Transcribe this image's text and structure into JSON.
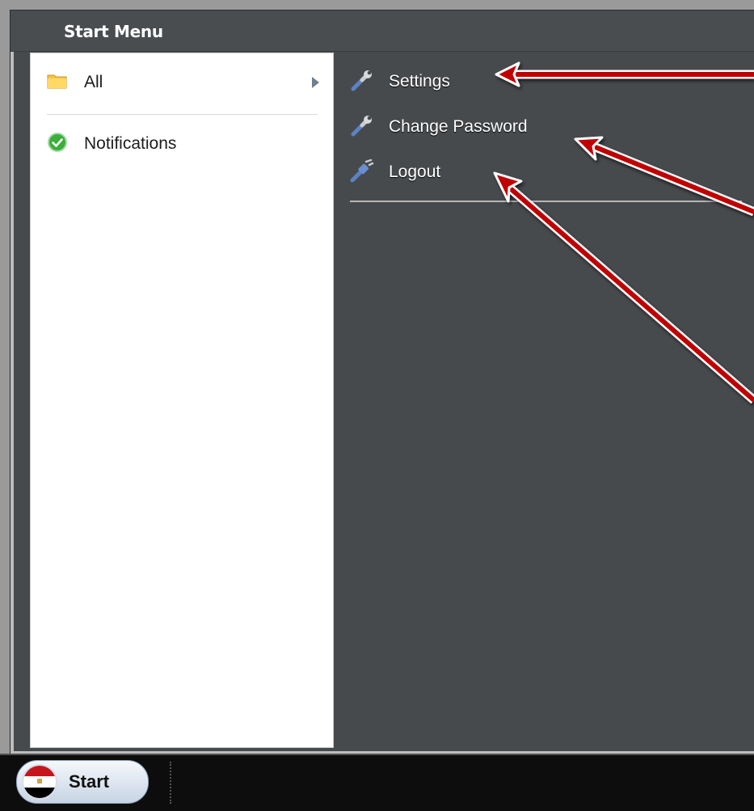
{
  "window": {
    "title": "Start Menu"
  },
  "left_menu": {
    "items": [
      {
        "label": "All",
        "icon": "folder-icon",
        "has_submenu": true
      },
      {
        "label": "Notifications",
        "icon": "check-circle-icon",
        "has_submenu": false
      }
    ]
  },
  "right_menu": {
    "items": [
      {
        "label": "Settings",
        "icon": "wrench-icon"
      },
      {
        "label": "Change Password",
        "icon": "wrench-icon"
      },
      {
        "label": "Logout",
        "icon": "plug-icon"
      }
    ]
  },
  "taskbar": {
    "start_label": "Start",
    "start_icon": "egypt-flag-icon"
  },
  "colors": {
    "panel_dark": "#474a4d",
    "panel_light": "#ffffff",
    "annotation_arrow": "#c00000"
  }
}
